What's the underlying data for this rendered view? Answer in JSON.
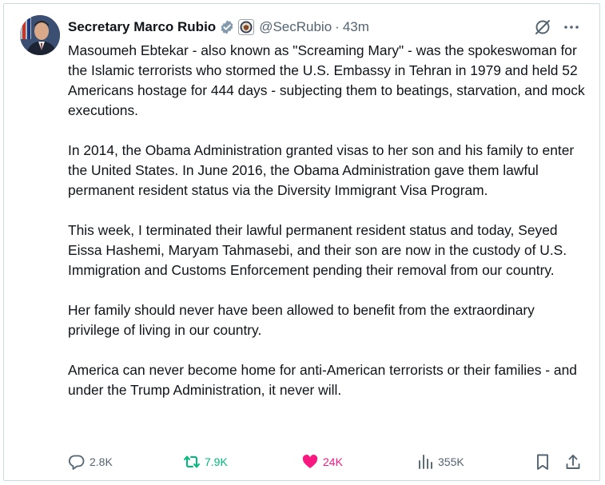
{
  "post": {
    "author": {
      "name": "Secretary Marco Rubio",
      "handle": "@SecRubio",
      "separator": "·",
      "time": "43m"
    },
    "paragraphs": [
      "Masoumeh Ebtekar - also known as \"Screaming Mary\" - was the spokeswoman for the Islamic terrorists who stormed the U.S. Embassy in Tehran in 1979 and held 52 Americans hostage for 444 days - subjecting them to beatings, starvation, and mock executions.",
      "In 2014, the Obama Administration granted visas to her son and his family to enter the United States. In June 2016, the Obama Administration gave them lawful permanent resident status via the Diversity Immigrant Visa Program.",
      "This week, I terminated their lawful permanent resident status and today, Seyed Eissa Hashemi, Maryam Tahmasebi, and their son are now in the custody of U.S. Immigration and Customs Enforcement pending their removal from our country.",
      "Her family should never have been allowed to benefit from the extraordinary privilege of living in our country.",
      "America can never become home for anti-American terrorists or their families - and under the Trump Administration, it never will."
    ],
    "stats": {
      "replies": "2.8K",
      "reposts": "7.9K",
      "likes": "24K",
      "views": "355K"
    }
  },
  "icons": {
    "verified": "verified-badge-icon",
    "affiliate": "state-department-seal-icon",
    "grok": "grok-icon",
    "more": "more-icon",
    "reply": "reply-icon",
    "repost": "repost-icon",
    "like": "heart-icon",
    "views": "views-icon",
    "bookmark": "bookmark-icon",
    "share": "share-icon"
  },
  "colors": {
    "text": "#0f1419",
    "secondary": "#536471",
    "repost_active": "#00ba7c",
    "like_active": "#f91880",
    "verified_badge": "#829aab",
    "border": "#cfd9de"
  }
}
